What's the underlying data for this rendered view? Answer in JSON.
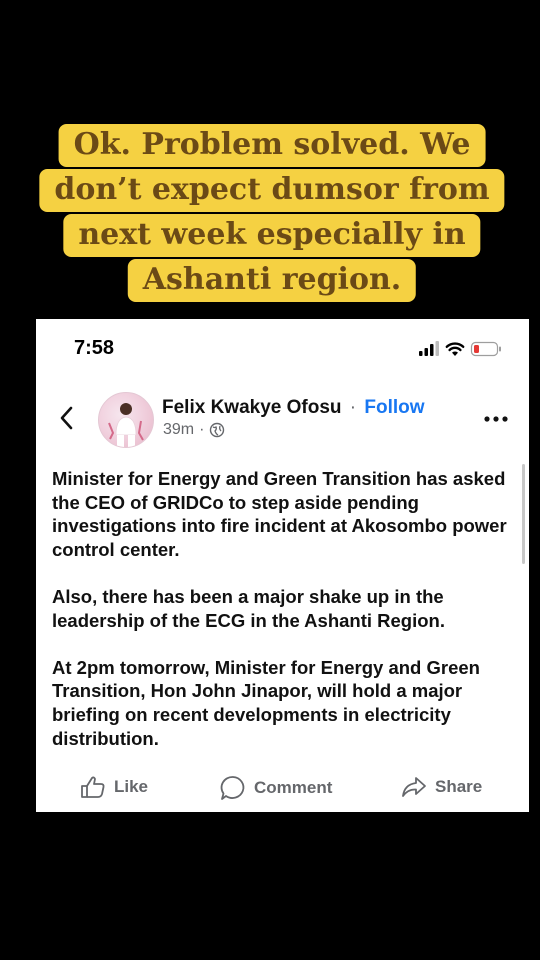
{
  "caption": {
    "lines": [
      "Ok. Problem solved. We",
      "don’t expect dumsor from",
      "next week especially in",
      "Ashanti region."
    ]
  },
  "status_bar": {
    "time": "7:58",
    "icons": [
      "signal-icon",
      "wifi-icon",
      "battery-icon"
    ]
  },
  "post": {
    "author": "Felix Kwakye Ofosu",
    "separator": "·",
    "follow_label": "Follow",
    "time": "39m",
    "meta_separator": "·",
    "paragraphs": [
      "Minister for Energy and Green Transition has asked the CEO of GRIDCo  to step aside pending investigations into fire incident at Akosombo power control center.",
      "Also, there has been a major shake up in the leadership of the ECG in the Ashanti Region.",
      "At 2pm tomorrow, Minister for Energy and Green Transition, Hon John Jinapor, will hold a major briefing on recent developments in electricity distribution."
    ]
  },
  "actions": {
    "like": "Like",
    "comment": "Comment",
    "share": "Share"
  },
  "colors": {
    "caption_bg": "#f5d142",
    "caption_text": "#6b4a16",
    "follow": "#1877f2",
    "battery_low": "#e53935"
  }
}
